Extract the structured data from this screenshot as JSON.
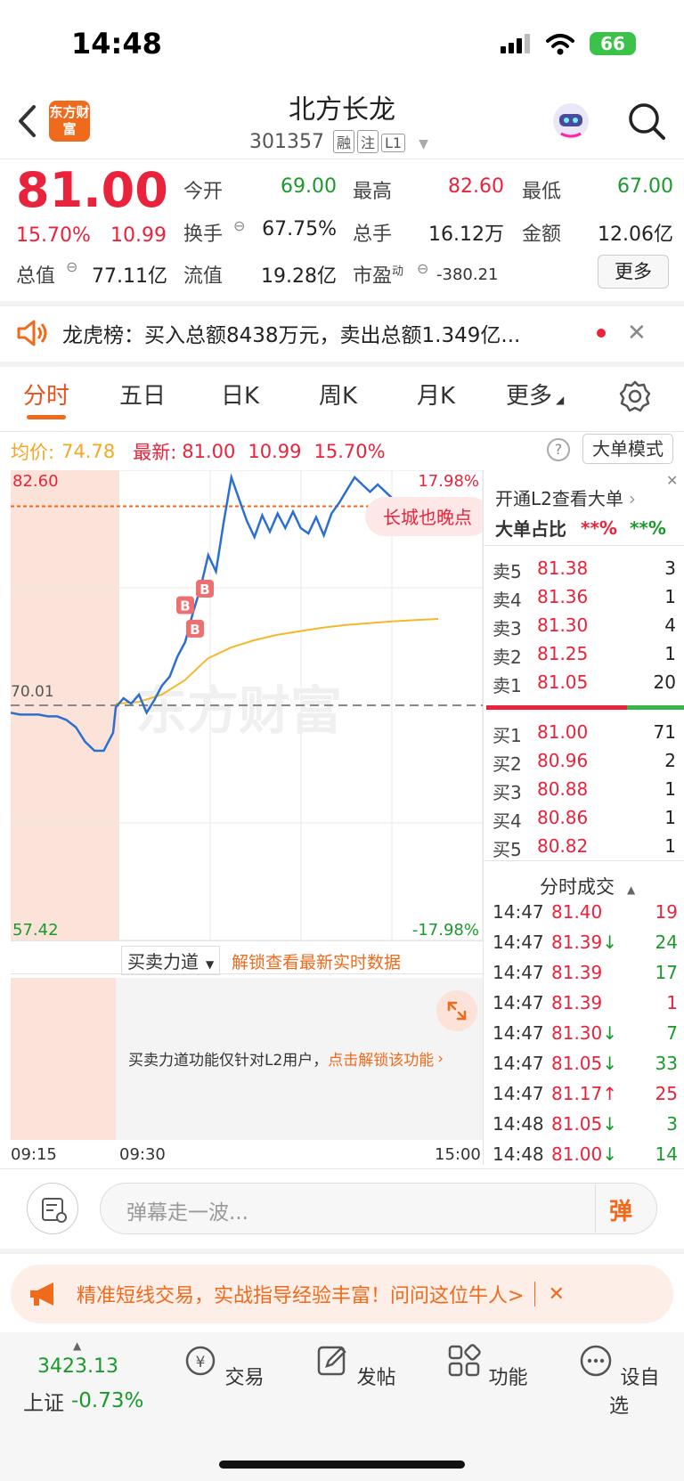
{
  "status_bar": {
    "time": "14:48",
    "battery": "66"
  },
  "header": {
    "logo_text": "东方财富",
    "stock_name": "北方长龙",
    "stock_code": "301357",
    "tags": [
      "融",
      "注",
      "L1"
    ]
  },
  "quote": {
    "price": "81.00",
    "change_pct": "15.70%",
    "change_abs": "10.99",
    "fields": [
      {
        "label": "今开",
        "value": "69.00"
      },
      {
        "label": "最高",
        "value": "82.60"
      },
      {
        "label": "最低",
        "value": "67.00"
      },
      {
        "label": "换手",
        "value": "67.75%"
      },
      {
        "label": "总手",
        "value": "16.12万"
      },
      {
        "label": "金额",
        "value": "12.06亿"
      },
      {
        "label": "总值",
        "value": "77.11亿"
      },
      {
        "label": "流值",
        "value": "19.28亿"
      },
      {
        "label": "市盈",
        "sup": "动",
        "value": "-380.21"
      }
    ],
    "more_label": "更多"
  },
  "notice": {
    "text": "龙虎榜：买入总额8438万元，卖出总额1.349亿..."
  },
  "tabs": [
    "分时",
    "五日",
    "日K",
    "周K",
    "月K",
    "更多"
  ],
  "chart_info": {
    "avg_label": "均价:",
    "avg_value": "74.78",
    "latest_label": "最新:",
    "latest_value": "81.00",
    "latest_change": "10.99",
    "latest_pct": "15.70%",
    "mode_button": "大单模式",
    "watermark": "东方财富",
    "banner_text": "长城也晚点"
  },
  "chart_data": {
    "type": "line",
    "title": "",
    "ylim": [
      57.42,
      82.6
    ],
    "y_top_label": "82.60",
    "y_bottom_label": "57.42",
    "y_top_pct": "17.98%",
    "y_bottom_pct": "-17.98%",
    "prev_close_label": "70.01",
    "prev_close": 70.01,
    "latest": 81.0,
    "x_labels": [
      "09:15",
      "09:30",
      "15:00"
    ],
    "series": [
      {
        "values": [
          69.6,
          69.5,
          69.5,
          69.5,
          69.4,
          69.4,
          69.2,
          68.8,
          68.0,
          67.5,
          67.5,
          68.5,
          69.9,
          70.4,
          70.1,
          70.6,
          69.6,
          70.3,
          71.1,
          71.6,
          72.7,
          73.5,
          75.1,
          76.5,
          78.3,
          77.4,
          80.1,
          82.6,
          81.4,
          80.2,
          79.3,
          80.5,
          79.6,
          80.6,
          79.8,
          80.7,
          79.8,
          79.5,
          80.4,
          79.4,
          80.6,
          81.2,
          81.9,
          82.6,
          82.2,
          81.8,
          82.2,
          81.8,
          81.4,
          81.1,
          81.0,
          80.7,
          80.8,
          80.6,
          81.3,
          81.0
        ]
      },
      {
        "values": [
          70.1,
          70.2,
          70.6,
          71.4,
          72.6,
          73.2,
          73.6,
          73.9,
          74.1,
          74.3,
          74.45,
          74.55,
          74.65,
          74.72,
          74.78
        ]
      }
    ]
  },
  "order_book": {
    "header": "开通L2查看大单",
    "ratio_label": "大单占比",
    "ratio_buy": "**%",
    "ratio_sell": "**%",
    "asks": [
      {
        "label": "卖5",
        "price": "81.38",
        "vol": "3"
      },
      {
        "label": "卖4",
        "price": "81.36",
        "vol": "1"
      },
      {
        "label": "卖3",
        "price": "81.30",
        "vol": "4"
      },
      {
        "label": "卖2",
        "price": "81.25",
        "vol": "1"
      },
      {
        "label": "卖1",
        "price": "81.05",
        "vol": "20"
      }
    ],
    "bids": [
      {
        "label": "买1",
        "price": "81.00",
        "vol": "71"
      },
      {
        "label": "买2",
        "price": "80.96",
        "vol": "2"
      },
      {
        "label": "买3",
        "price": "80.88",
        "vol": "1"
      },
      {
        "label": "买4",
        "price": "80.86",
        "vol": "1"
      },
      {
        "label": "买5",
        "price": "80.82",
        "vol": "1"
      }
    ],
    "trades_header": "分时成交",
    "trades": [
      {
        "time": "14:47",
        "price": "81.40",
        "arrow": "",
        "vol": "19",
        "dir": "buy"
      },
      {
        "time": "14:47",
        "price": "81.39",
        "arrow": "↓",
        "vol": "24",
        "dir": "sell"
      },
      {
        "time": "14:47",
        "price": "81.39",
        "arrow": "",
        "vol": "17",
        "dir": "sell"
      },
      {
        "time": "14:47",
        "price": "81.39",
        "arrow": "",
        "vol": "1",
        "dir": "buy"
      },
      {
        "time": "14:47",
        "price": "81.30",
        "arrow": "↓",
        "vol": "7",
        "dir": "sell"
      },
      {
        "time": "14:47",
        "price": "81.05",
        "arrow": "↓",
        "vol": "33",
        "dir": "sell"
      },
      {
        "time": "14:47",
        "price": "81.17",
        "arrow": "↑",
        "vol": "25",
        "dir": "buy"
      },
      {
        "time": "14:48",
        "price": "81.05",
        "arrow": "↓",
        "vol": "3",
        "dir": "sell"
      },
      {
        "time": "14:48",
        "price": "81.00",
        "arrow": "↓",
        "vol": "14",
        "dir": "sell"
      }
    ]
  },
  "power": {
    "selector": "买卖力道",
    "unlock_link": "解锁查看最新实时数据",
    "info": "买卖力道功能仅针对L2用户，",
    "info_link": "点击解锁该功能"
  },
  "comment": {
    "placeholder": "弹幕走一波...",
    "send_label": "弹"
  },
  "promo": {
    "text": "精准短线交易，实战指导经验丰富！问问这位牛人>"
  },
  "bottom_nav": {
    "index_value": "3423.13",
    "index_name": "上证",
    "index_change": "-0.73%",
    "items": [
      "交易",
      "发帖",
      "功能",
      "设自选"
    ]
  }
}
